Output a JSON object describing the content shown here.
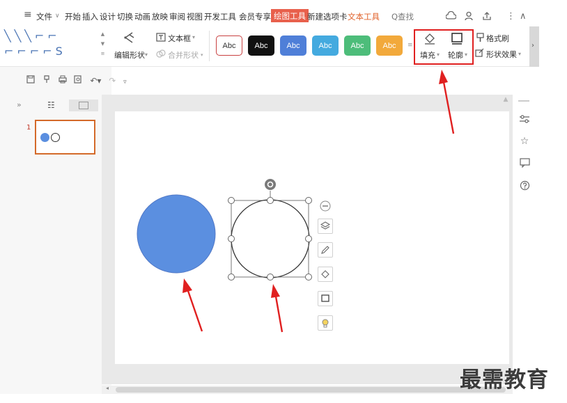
{
  "menubar": {
    "menu_icon": "≡",
    "file": "文件",
    "file_caret": "∨",
    "tabs": [
      "开始",
      "插入",
      "设计",
      "切换",
      "动画",
      "放映",
      "审阅",
      "视图",
      "开发工具",
      "会员专享"
    ],
    "active_tab": "绘图工具",
    "tab_new": "新建选项卡",
    "tab_text_tools": "文本工具",
    "search": "Q查找",
    "right_icons": [
      "cloud-icon",
      "share-user-icon",
      "upload-icon",
      "more-icon",
      "collapse-icon"
    ],
    "more": "⋮",
    "collapse": "∧"
  },
  "ribbon": {
    "shape_rows": [
      "╲╲╲⌐⌐",
      "⌐⌐⌐⌐S"
    ],
    "edit_shape": "编辑形状",
    "text_box": "文本框",
    "merge_shape": "合并形状",
    "styles": [
      {
        "label": "Abc",
        "bg": "#ffffff",
        "fg": "#333333",
        "border": "#c84040"
      },
      {
        "label": "Abc",
        "bg": "#111111",
        "fg": "#ffffff",
        "border": "#111111"
      },
      {
        "label": "Abc",
        "bg": "#4f7fd8",
        "fg": "#ffffff",
        "border": "#4f7fd8"
      },
      {
        "label": "Abc",
        "bg": "#44aadf",
        "fg": "#ffffff",
        "border": "#44aadf"
      },
      {
        "label": "Abc",
        "bg": "#4dbd7a",
        "fg": "#ffffff",
        "border": "#4dbd7a"
      },
      {
        "label": "Abc",
        "bg": "#f2a93b",
        "fg": "#ffffff",
        "border": "#f2a93b"
      }
    ],
    "fill": "填充",
    "outline": "轮廓",
    "format_painter": "格式刷",
    "shape_effects": "形状效果",
    "ribbon_more": "›"
  },
  "qat": [
    "save-icon",
    "paint-icon",
    "print-icon",
    "preview-icon",
    "undo-icon",
    "redo-icon",
    "customize-icon"
  ],
  "left_panel": {
    "expand": "»",
    "slide_number": "1"
  },
  "watermark": "最需教育",
  "colors": {
    "accent": "#e8604c",
    "circle_fill": "#5b8fe0",
    "annotation_red": "#e02020"
  }
}
